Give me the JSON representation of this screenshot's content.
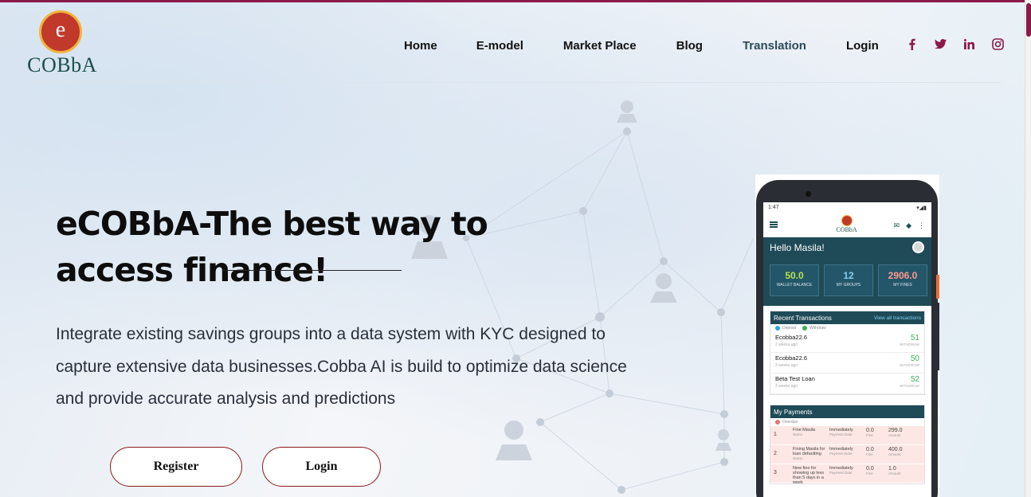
{
  "brand": {
    "logo_letter": "e",
    "logo_text": "COBbA"
  },
  "nav": [
    {
      "label": "Home"
    },
    {
      "label": "E-model"
    },
    {
      "label": "Market Place"
    },
    {
      "label": "Blog"
    },
    {
      "label": "Translation"
    },
    {
      "label": "Login"
    }
  ],
  "socials": [
    "facebook-icon",
    "twitter-icon",
    "linkedin-icon",
    "instagram-icon"
  ],
  "colors": {
    "accent": "#8b1a4a",
    "brand_red": "#c0392b",
    "brand_teal": "#1d4f4c",
    "app_panel": "#1f4a57"
  },
  "hero": {
    "title": "eCOBbA-The best way to access finance!",
    "description": "Integrate existing savings groups into a data system with KYC designed to capture extensive data businesses.Cobba AI is build to optimize data science and provide accurate analysis and predictions",
    "register_label": "Register",
    "login_label": "Login"
  },
  "phone": {
    "time": "1:47",
    "app_logo_text": "COBbA",
    "greeting": "Hello Masila!",
    "stats": [
      {
        "value": "50.0",
        "label": "WALLET BALANCE"
      },
      {
        "value": "12",
        "label": "MY GROUPS"
      },
      {
        "value": "2906.0",
        "label": "MY FINES"
      }
    ],
    "recent_title": "Recent Transactions",
    "view_all": "View all transactions",
    "legend": [
      "Deposit",
      "Withdraw"
    ],
    "transactions": [
      {
        "name": "Ecobba22.6",
        "date": "2 weeks ago",
        "amount": "51",
        "type": "WITHDRAW"
      },
      {
        "name": "Ecobba22.6",
        "date": "3 weeks ago",
        "amount": "50",
        "type": "WITHDRAW"
      },
      {
        "name": "Beta Test Loan",
        "date": "3 weeks ago",
        "amount": "52",
        "type": "WITHDRAW"
      }
    ],
    "payments_title": "My Payments",
    "payments_sub": "Overdue",
    "payments": [
      {
        "num": "1",
        "name": "Fine:Masila",
        "when": "Immediately",
        "fine": "0.0",
        "amount": "299.0"
      },
      {
        "num": "2",
        "name": "Fining Masila for loan defaulting",
        "when": "Immediately",
        "fine": "0.0",
        "amount": "400.0"
      },
      {
        "num": "3",
        "name": "New fine for showing up less than 5 days in a week",
        "when": "Immediately",
        "fine": "0.0",
        "amount": "1.0"
      }
    ],
    "col_labels": {
      "name": "Name",
      "date": "Payment Date",
      "fine": "Fine",
      "amount": "Amount"
    }
  }
}
